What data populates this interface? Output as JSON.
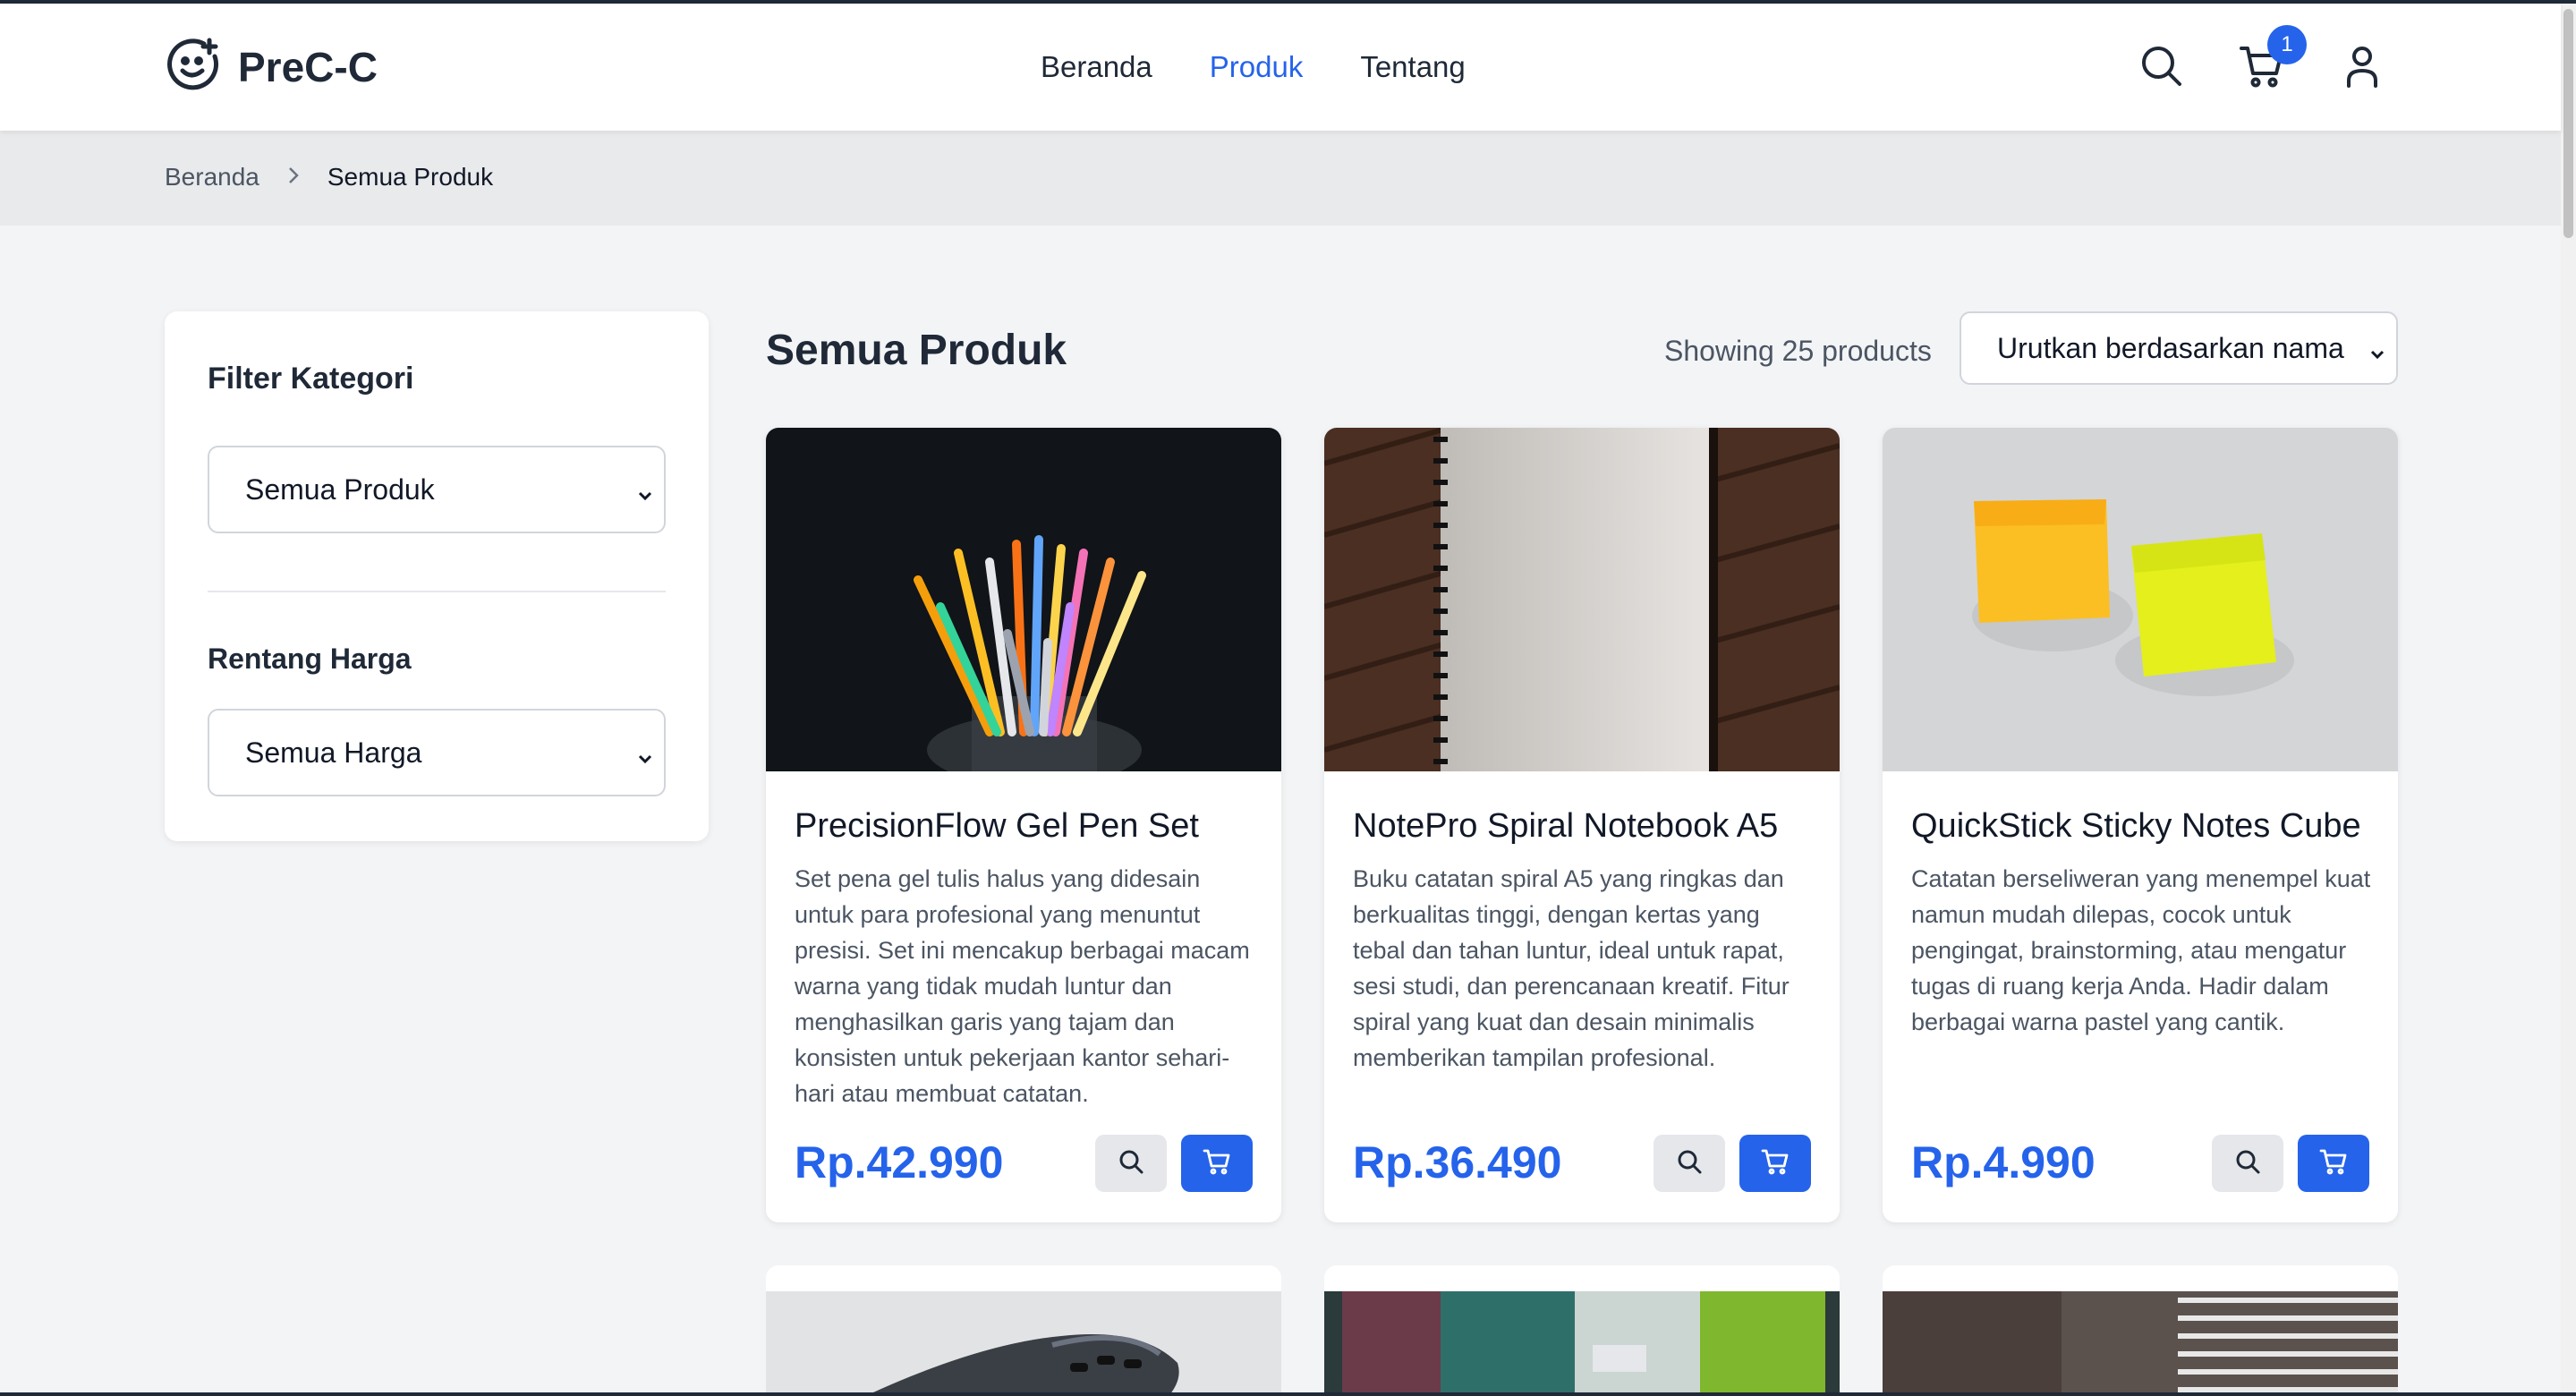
{
  "brand": {
    "name": "PreC-C"
  },
  "nav": {
    "items": [
      {
        "label": "Beranda"
      },
      {
        "label": "Produk"
      },
      {
        "label": "Tentang"
      }
    ],
    "active": "Produk"
  },
  "header": {
    "cart_count": "1"
  },
  "breadcrumb": {
    "home": "Beranda",
    "current": "Semua Produk"
  },
  "sidebar": {
    "category_title": "Filter Kategori",
    "category_value": "Semua Produk",
    "price_title": "Rentang Harga",
    "price_value": "Semua Harga"
  },
  "main": {
    "title": "Semua Produk",
    "count_text": "Showing 25 products",
    "sort_value": "Urutkan berdasarkan nama"
  },
  "products": [
    {
      "name": "PrecisionFlow Gel Pen Set",
      "description": "Set pena gel tulis halus yang didesain untuk para profesional yang menuntut presisi. Set ini mencakup berbagai macam warna yang tidak mudah luntur dan menghasilkan garis yang tajam dan konsisten untuk pekerjaan kantor sehari-hari atau membuat catatan.",
      "price": "Rp.42.990"
    },
    {
      "name": "NotePro Spiral Notebook A5",
      "description": "Buku catatan spiral A5 yang ringkas dan berkualitas tinggi, dengan kertas yang tebal dan tahan luntur, ideal untuk rapat, sesi studi, dan perencanaan kreatif. Fitur spiral yang kuat dan desain minimalis memberikan tampilan profesional.",
      "price": "Rp.36.490"
    },
    {
      "name": "QuickStick Sticky Notes Cube",
      "description": "Catatan berseliweran yang menempel kuat namun mudah dilepas, cocok untuk pengingat, brainstorming, atau mengatur tugas di ruang kerja Anda. Hadir dalam berbagai warna pastel yang cantik.",
      "price": "Rp.4.990"
    }
  ],
  "colors": {
    "accent": "#2563eb",
    "text": "#1f2937",
    "muted": "#4b5563",
    "page_bg": "#f3f4f6"
  },
  "icons": [
    "smile-logo-icon",
    "search-icon",
    "cart-icon",
    "user-icon",
    "chevron-right-icon",
    "chevron-down-icon",
    "magnify-icon"
  ]
}
